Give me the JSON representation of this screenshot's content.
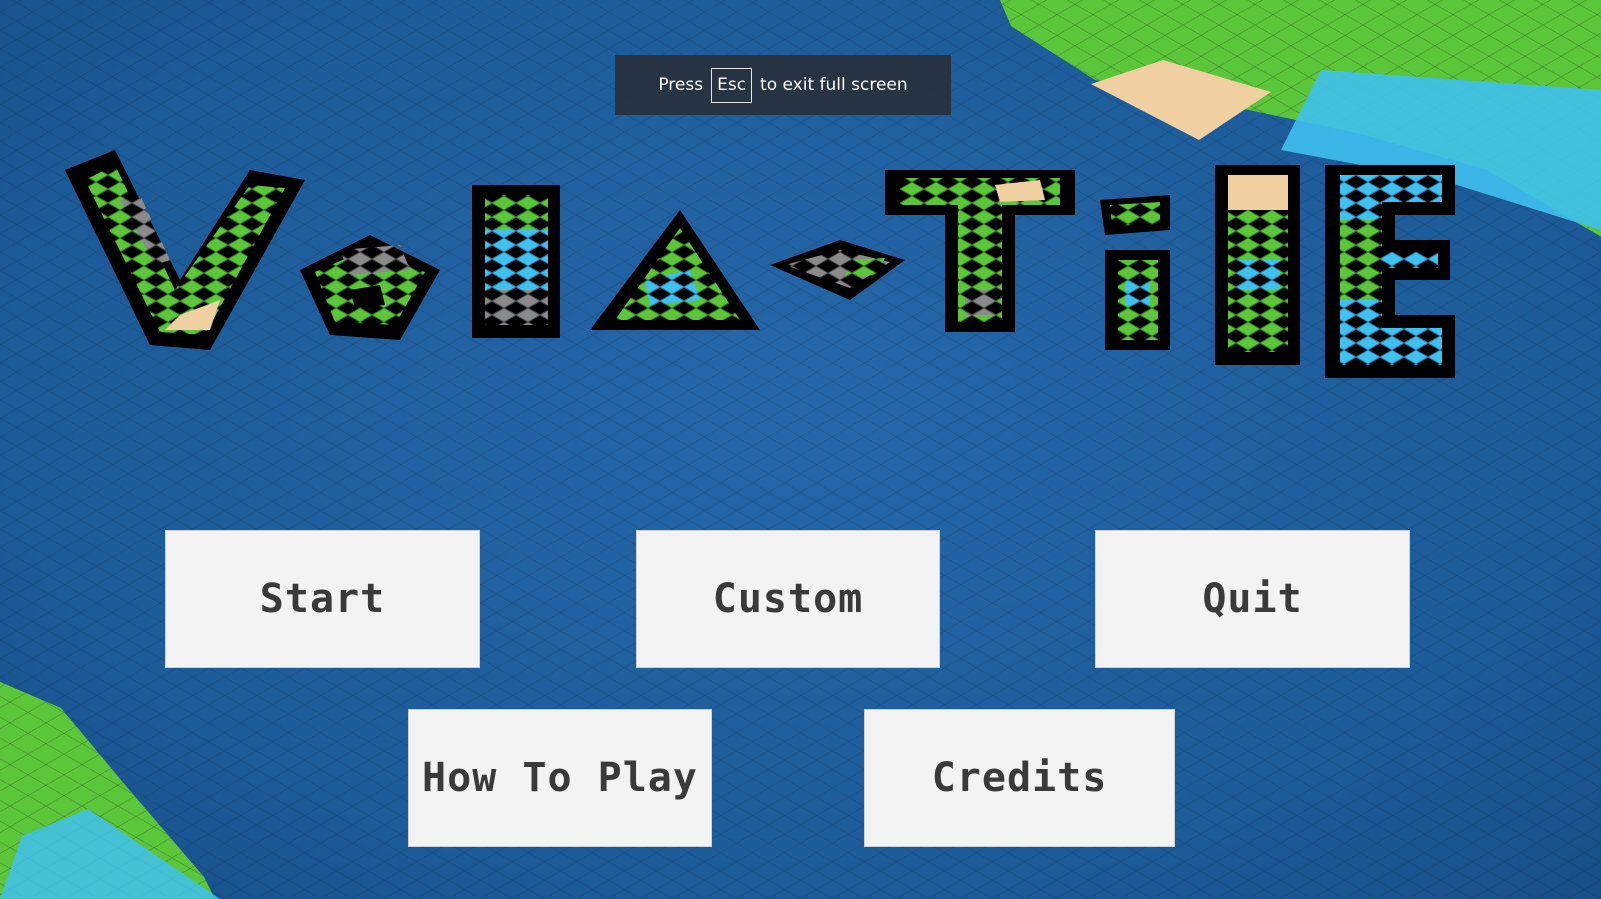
{
  "fullscreen_notice": {
    "prefix": "Press",
    "key": "Esc",
    "suffix": "to exit full screen"
  },
  "logo": {
    "text": "Vola-Tile"
  },
  "menu": {
    "start_label": "Start",
    "custom_label": "Custom",
    "quit_label": "Quit",
    "howto_label": "How To Play",
    "credits_label": "Credits"
  },
  "colors": {
    "ocean": "#1f5f9e",
    "grass": "#5cc63a",
    "shallow_water": "#3fc0ee",
    "sand": "#f0cfa0",
    "rock": "#8a8a8a",
    "button_bg": "#f3f3f3",
    "button_text": "#3a3a3a"
  }
}
